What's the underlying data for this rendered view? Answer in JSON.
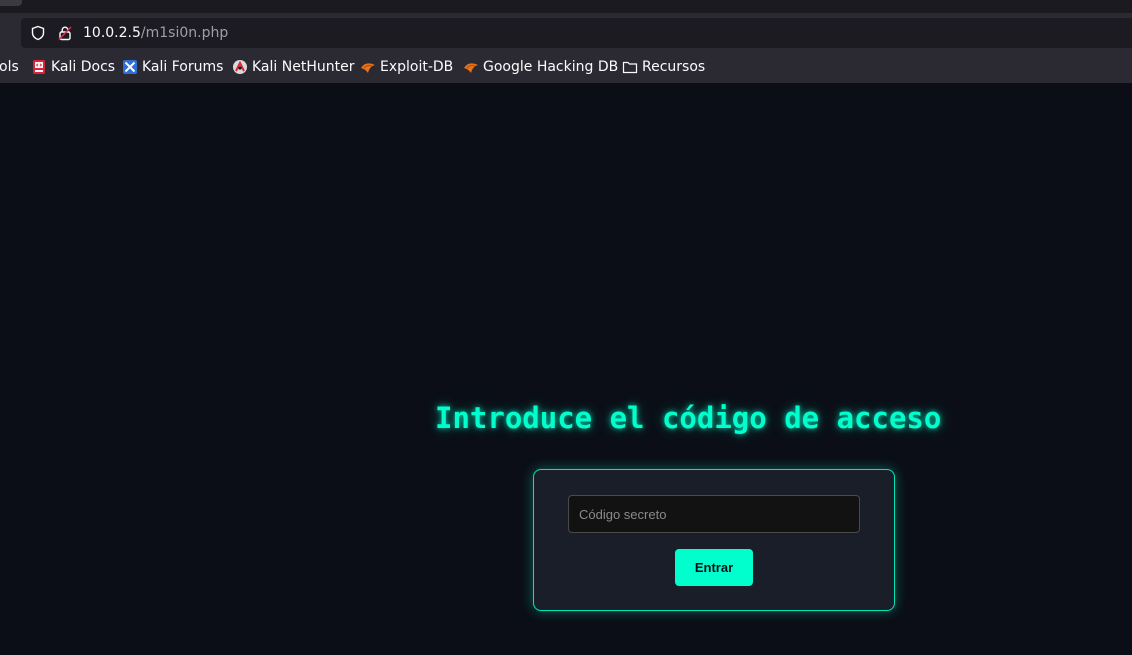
{
  "browser": {
    "url_host": "10.0.2.5",
    "url_path": "/m1si0n.php",
    "bookmarks": [
      {
        "label": "ols",
        "icon": "partial-bookmark"
      },
      {
        "label": "Kali Docs",
        "icon": "kali-docs-icon"
      },
      {
        "label": "Kali Forums",
        "icon": "kali-forums-icon"
      },
      {
        "label": "Kali NetHunter",
        "icon": "kali-nethunter-icon"
      },
      {
        "label": "Exploit-DB",
        "icon": "exploit-db-icon"
      },
      {
        "label": "Google Hacking DB",
        "icon": "exploit-db-icon"
      },
      {
        "label": "Recursos",
        "icon": "folder-icon"
      }
    ]
  },
  "page": {
    "title": "Introduce el código de acceso",
    "input_placeholder": "Código secreto",
    "button_label": "Entrar",
    "accent_color": "#00ffcc",
    "background_color": "#0b0e17"
  }
}
